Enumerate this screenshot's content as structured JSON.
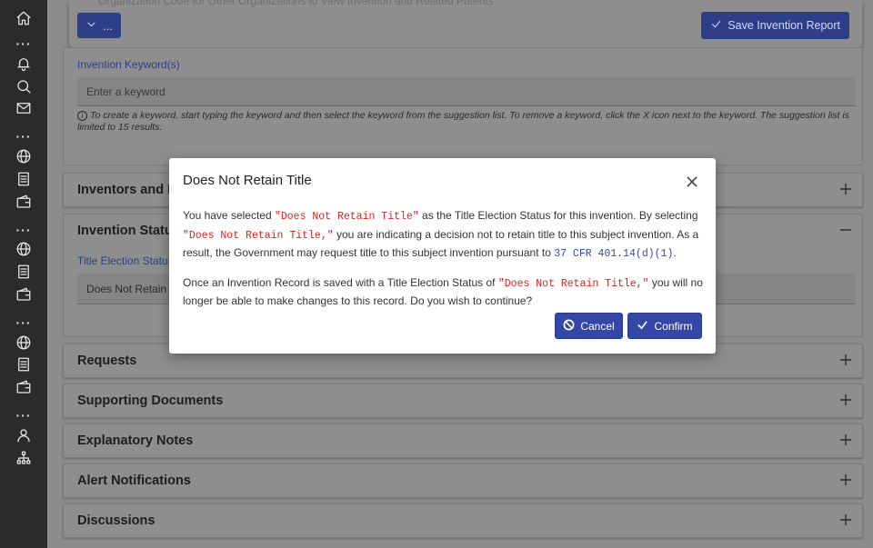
{
  "topbar": {
    "faded_text": "Organization Code for Other Organizations to View Invention and Related Patents",
    "menu_button_label": "...",
    "save_label": "Save Invention Report"
  },
  "keywords": {
    "label": "Invention Keyword(s)",
    "placeholder": "Enter a keyword",
    "help": "To create a keyword, start typing the keyword and then select the keyword from the suggestion list. To remove a keyword, click the X icon next to the keyword. The suggestion list is limited to 15 results."
  },
  "sections": {
    "inventors": "Inventors and F",
    "status": "Invention Statu",
    "requests": "Requests",
    "supporting_docs": "Supporting Documents",
    "explanatory_notes": "Explanatory Notes",
    "alert_notifications": "Alert Notifications",
    "discussions": "Discussions"
  },
  "status_section": {
    "title_election_label": "Title Election Status",
    "title_election_value": "Does Not Retain T"
  },
  "modal": {
    "title": "Does Not Retain Title",
    "p1_a": "You have selected ",
    "p1_code1": "\"Does Not Retain Title\"",
    "p1_b": " as the Title Election Status for this invention. By selecting ",
    "p1_code2": "\"Does Not Retain Title,\"",
    "p1_c": " you are indicating a decision not to retain title to this subject invention. As a result, the Government may request title to this subject invention pursuant to ",
    "p1_code3": "37 CFR 401.14(d)(1)",
    "p1_d": ".",
    "p2_a": "Once an Invention Record is saved with a Title Election Status of ",
    "p2_code": "\"Does Not Retain Title,\"",
    "p2_b": " you will no longer be able to make changes to this record. Do you wish to continue?",
    "cancel_label": "Cancel",
    "confirm_label": "Confirm"
  }
}
